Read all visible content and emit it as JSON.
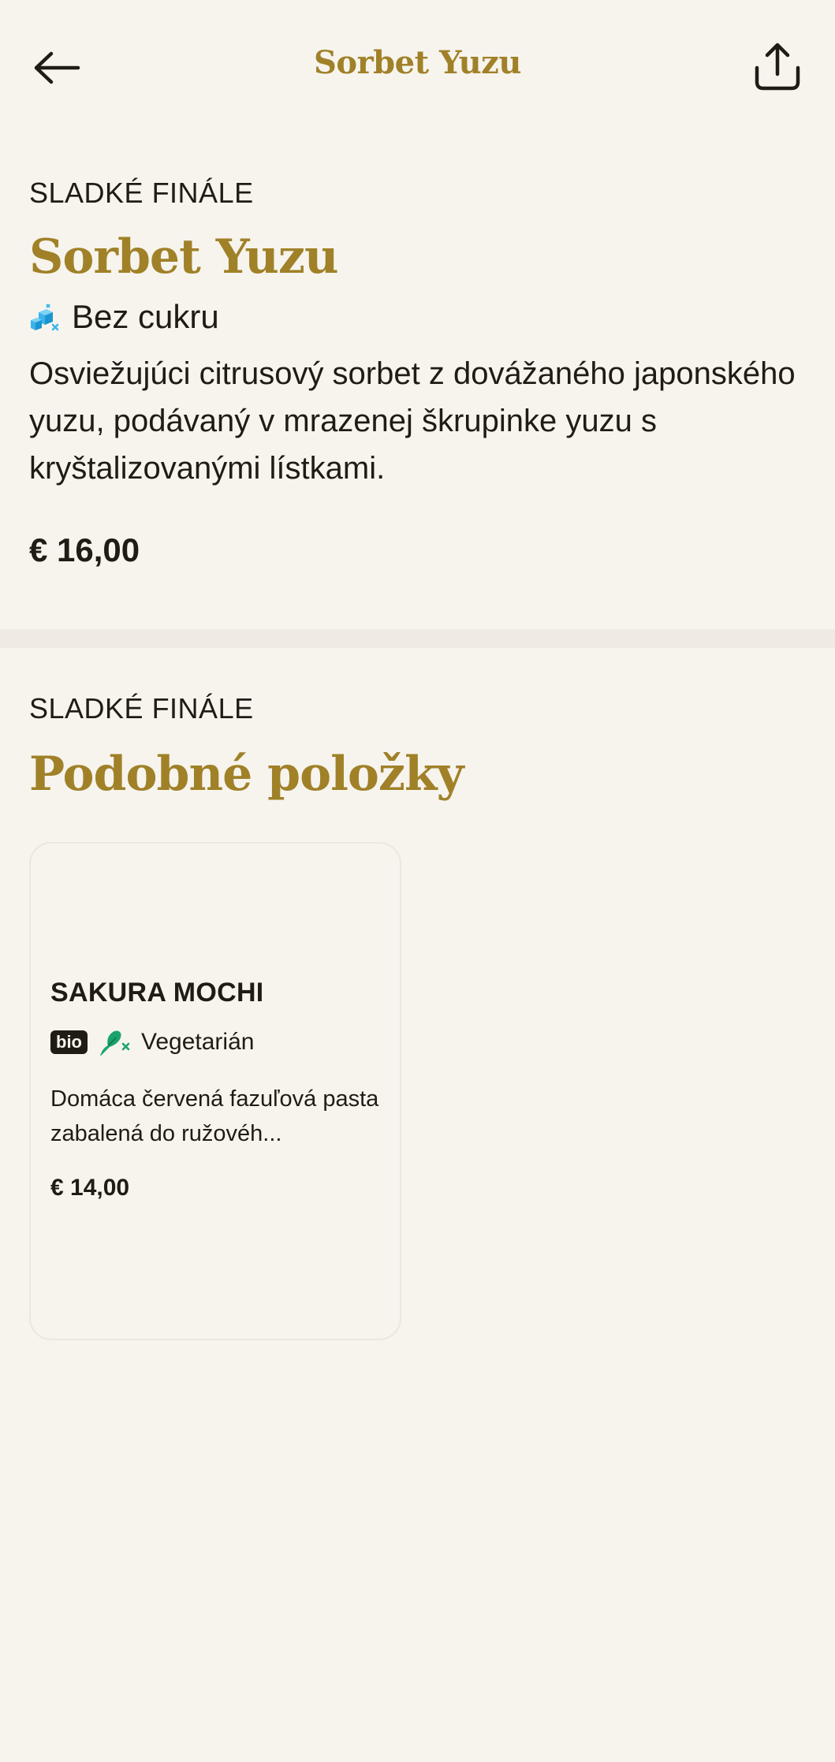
{
  "header": {
    "title": "Sorbet Yuzu",
    "back_icon": "arrow-left-icon",
    "share_icon": "share-icon"
  },
  "item": {
    "category": "SLADKÉ FINÁLE",
    "title": "Sorbet Yuzu",
    "tag": {
      "icon": "sugar-free-icon",
      "label": "Bez cukru"
    },
    "description": "Osviežujúci citrusový sorbet z dovážaného japonského yuzu, podávaný v mrazenej škrupinke yuzu s kryštalizovanými lístkami.",
    "price": "€ 16,00"
  },
  "similar": {
    "category": "SLADKÉ FINÁLE",
    "title": "Podobné položky",
    "items": [
      {
        "name": "SAKURA MOCHI",
        "bio_badge": "bio",
        "tag_icon": "vegetarian-icon",
        "tag_label": "Vegetarián",
        "description": "Domáca červená fazuľová pasta zabalená do ružovéh...",
        "price": "€ 14,00"
      }
    ]
  },
  "colors": {
    "background": "#f7f4ee",
    "accent": "#a08128",
    "text": "#1f1c14",
    "divider": "#efebe2",
    "sugar_free_icon": "#3ab4ec",
    "vegetarian_icon": "#1aa36a"
  }
}
